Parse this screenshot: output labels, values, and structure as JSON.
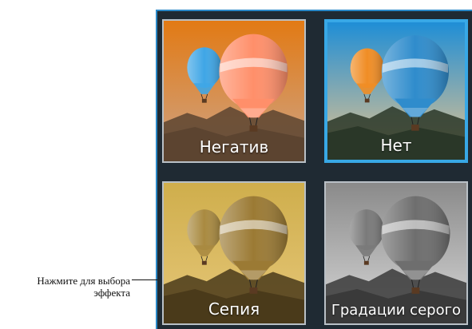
{
  "tiles": [
    {
      "label": "Негатив",
      "selected": false,
      "palette": {
        "sky_top": "#e27a14",
        "sky_bottom": "#cda487",
        "ground": "#5c4430",
        "balloon_main": "#ff8f6a",
        "balloon_back": "#3fa6e6"
      }
    },
    {
      "label": "Нет",
      "selected": true,
      "palette": {
        "sky_top": "#1f8ed6",
        "sky_bottom": "#e8c48d",
        "ground": "#2a3728",
        "balloon_main": "#2f8ccc",
        "balloon_back": "#f08d25"
      }
    },
    {
      "label": "Сепия",
      "selected": false,
      "palette": {
        "sky_top": "#cfae4c",
        "sky_bottom": "#e6c779",
        "ground": "#4a3a1a",
        "balloon_main": "#9b7a34",
        "balloon_back": "#a98a40"
      }
    },
    {
      "label": "Градации серого",
      "selected": false,
      "palette": {
        "sky_top": "#8a8a8a",
        "sky_bottom": "#d8d8d8",
        "ground": "#3a3a3a",
        "balloon_main": "#6e6e6e",
        "balloon_back": "#7a7a7a"
      }
    }
  ],
  "caption": {
    "line1": "Нажмите для выбора",
    "line2": "эффекта"
  },
  "accent_color": "#38a8e6"
}
